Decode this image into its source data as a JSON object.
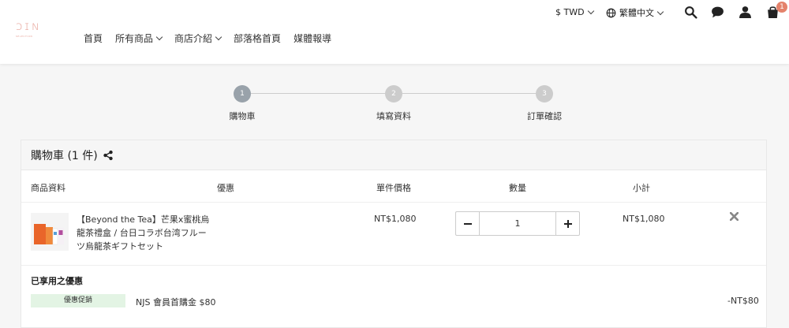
{
  "header": {
    "logo_text": "ɔɪɴ",
    "logo_sub": "SELECTION",
    "nav": [
      {
        "label": "首頁"
      },
      {
        "label": "所有商品"
      },
      {
        "label": "商店介紹"
      },
      {
        "label": "部落格首頁"
      },
      {
        "label": "媒體報導"
      }
    ],
    "currency": "$ TWD",
    "language": "繁體中文",
    "cart_count": "1"
  },
  "steps": [
    {
      "num": "1",
      "label": "購物車"
    },
    {
      "num": "2",
      "label": "填寫資料"
    },
    {
      "num": "3",
      "label": "訂單確認"
    }
  ],
  "cart": {
    "title": "購物車 (1 件)",
    "columns": {
      "product": "商品資料",
      "discount": "優惠",
      "unit_price": "單件價格",
      "quantity": "數量",
      "subtotal": "小計"
    },
    "item": {
      "name": "【Beyond the Tea】芒果x蜜桃烏龍茶禮盒 / 台日コラボ台湾フルーツ烏龍茶ギフトセット",
      "price": "NT$1,080",
      "quantity": "1",
      "subtotal": "NT$1,080"
    },
    "promotions": {
      "title": "已享用之優惠",
      "tag": "優惠促銷",
      "name": "NJS 會員首購金 $80",
      "value": "-NT$80"
    }
  },
  "colors": {
    "accent": "#e8a49a",
    "badge": "#e4826b",
    "step_active": "#99a2aa",
    "promo_tag_bg": "#e3f4e4"
  }
}
